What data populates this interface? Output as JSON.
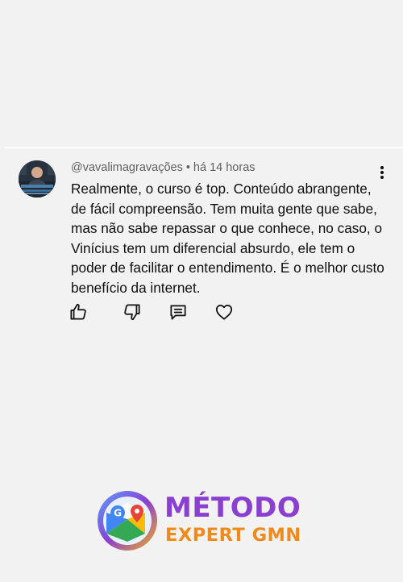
{
  "comment": {
    "author": "@vavalimagravações",
    "separator": "•",
    "time": "há 14 horas",
    "text": "Realmente, o curso é top. Conteúdo abrangente, de fácil compreensão. Tem muita gente que sabe, mas não sabe repassar o que conhece, no caso, o Vinícius tem um diferencial absurdo, ele tem o poder de facilitar o entendimento. É o melhor custo benefício da internet."
  },
  "actions": [
    {
      "icon": "thumbs-up-icon"
    },
    {
      "icon": "thumbs-down-icon"
    },
    {
      "icon": "reply-icon"
    },
    {
      "icon": "heart-icon"
    }
  ],
  "brand": {
    "line1": "MÉTODO",
    "line2": "EXPERT GMN",
    "colors": {
      "purple": "#8a3fd1",
      "orange": "#f08a1c",
      "blue": "#3b6fe0"
    }
  }
}
